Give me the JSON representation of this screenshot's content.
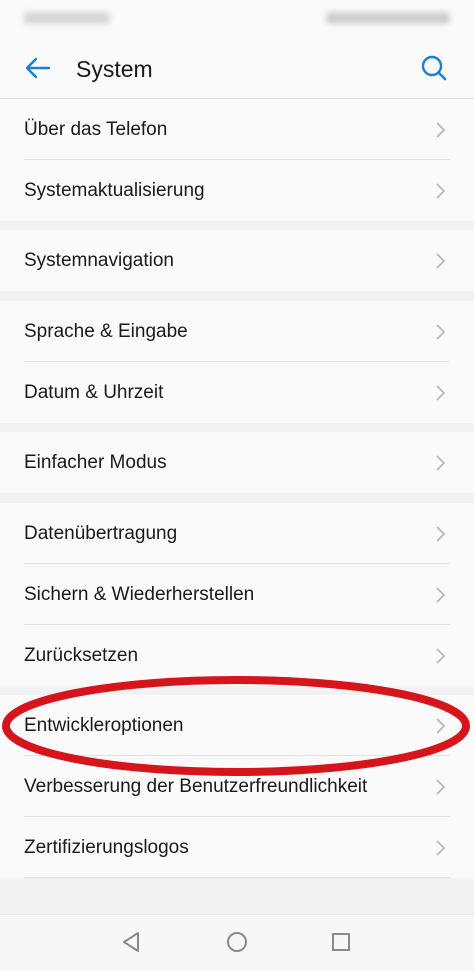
{
  "header": {
    "title": "System",
    "back_icon": "arrow-left-icon",
    "search_icon": "search-icon",
    "accent_color": "#1a7fd4"
  },
  "groups": [
    {
      "items": [
        {
          "label": "Über das Telefon"
        },
        {
          "label": "Systemaktualisierung"
        }
      ]
    },
    {
      "items": [
        {
          "label": "Systemnavigation"
        }
      ]
    },
    {
      "items": [
        {
          "label": "Sprache & Eingabe"
        },
        {
          "label": "Datum & Uhrzeit"
        }
      ]
    },
    {
      "items": [
        {
          "label": "Einfacher Modus"
        }
      ]
    },
    {
      "items": [
        {
          "label": "Datenübertragung"
        },
        {
          "label": "Sichern & Wiederherstellen"
        },
        {
          "label": "Zurücksetzen"
        }
      ]
    },
    {
      "items": [
        {
          "label": "Entwickleroptionen"
        },
        {
          "label": "Verbesserung der Benutzerfreundlichkeit"
        },
        {
          "label": "Zertifizierungslogos"
        }
      ]
    }
  ],
  "annotation": {
    "highlighted_item": "Entwickleroptionen",
    "color": "#d6141c"
  },
  "nav_bar": {
    "back_icon": "triangle-back-icon",
    "home_icon": "circle-home-icon",
    "recents_icon": "square-recents-icon"
  }
}
